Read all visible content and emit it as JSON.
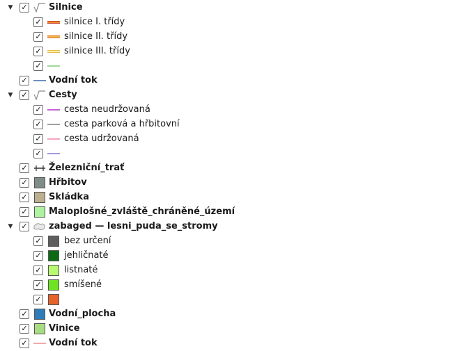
{
  "layers": [
    {
      "label": "Silnice",
      "level": 0,
      "bold": true,
      "expanded": true,
      "checked": true,
      "symbol": {
        "type": "rule-icon"
      }
    },
    {
      "label": "silnice I. třídy",
      "level": 1,
      "checked": true,
      "symbol": {
        "type": "road",
        "fill": "#f08c28",
        "border": "#c0392b"
      }
    },
    {
      "label": "silnice II. třídy",
      "level": 1,
      "checked": true,
      "symbol": {
        "type": "road",
        "fill": "#f5b35a",
        "border": "#e07b18"
      }
    },
    {
      "label": "silnice III. třídy",
      "level": 1,
      "checked": true,
      "symbol": {
        "type": "road",
        "fill": "#fff3a8",
        "border": "#e6b84d"
      }
    },
    {
      "label": "",
      "level": 1,
      "checked": true,
      "symbol": {
        "type": "line",
        "color": "#9ed99a"
      }
    },
    {
      "label": "Vodní tok",
      "level": 0,
      "bold": true,
      "checked": true,
      "symbol": {
        "type": "line",
        "color": "#6d8fbf"
      }
    },
    {
      "label": "Cesty",
      "level": 0,
      "bold": true,
      "expanded": true,
      "checked": true,
      "symbol": {
        "type": "rule-icon"
      }
    },
    {
      "label": "cesta neudržovaná",
      "level": 1,
      "checked": true,
      "symbol": {
        "type": "line",
        "color": "#c85fd8"
      }
    },
    {
      "label": "cesta parková a hřbitovní",
      "level": 1,
      "checked": true,
      "symbol": {
        "type": "line",
        "color": "#a0a0a0"
      }
    },
    {
      "label": "cesta udržovaná",
      "level": 1,
      "checked": true,
      "symbol": {
        "type": "line",
        "color": "#f4a6c0"
      }
    },
    {
      "label": "",
      "level": 1,
      "checked": true,
      "symbol": {
        "type": "line",
        "color": "#a39be0"
      }
    },
    {
      "label": "Železniční_trať",
      "level": 0,
      "bold": true,
      "checked": true,
      "symbol": {
        "type": "rail",
        "color": "#333333"
      }
    },
    {
      "label": "Hřbitov",
      "level": 0,
      "bold": true,
      "checked": true,
      "symbol": {
        "type": "fill",
        "color": "#7f8c88"
      }
    },
    {
      "label": "Skládka",
      "level": 0,
      "bold": true,
      "checked": true,
      "symbol": {
        "type": "fill",
        "color": "#bcb08e"
      }
    },
    {
      "label": "Maloplošné_zvláště_chráněné_území",
      "level": 0,
      "bold": true,
      "checked": true,
      "symbol": {
        "type": "fill",
        "color": "#aef3a0"
      }
    },
    {
      "label": "zabaged — lesni_puda_se_stromy",
      "level": 0,
      "bold": true,
      "expanded": true,
      "checked": true,
      "symbol": {
        "type": "categorized-icon"
      }
    },
    {
      "label": "bez určení",
      "level": 1,
      "checked": true,
      "symbol": {
        "type": "fill",
        "color": "#5e5e5e"
      }
    },
    {
      "label": "jehličnaté",
      "level": 1,
      "checked": true,
      "symbol": {
        "type": "fill",
        "color": "#0b6b13"
      }
    },
    {
      "label": "listnaté",
      "level": 1,
      "checked": true,
      "symbol": {
        "type": "fill",
        "color": "#b9f871"
      }
    },
    {
      "label": "smíšené",
      "level": 1,
      "checked": true,
      "symbol": {
        "type": "fill",
        "color": "#6fe321"
      }
    },
    {
      "label": "",
      "level": 1,
      "checked": true,
      "symbol": {
        "type": "fill",
        "color": "#e8632a"
      }
    },
    {
      "label": "Vodní_plocha",
      "level": 0,
      "bold": true,
      "checked": true,
      "symbol": {
        "type": "fill",
        "color": "#2e7cb8"
      }
    },
    {
      "label": "Vinice",
      "level": 0,
      "bold": true,
      "checked": true,
      "symbol": {
        "type": "fill",
        "color": "#a8dc82"
      }
    },
    {
      "label": "Vodní tok",
      "level": 0,
      "bold": true,
      "checked": true,
      "symbol": {
        "type": "line",
        "color": "#f0a9a9"
      }
    }
  ]
}
